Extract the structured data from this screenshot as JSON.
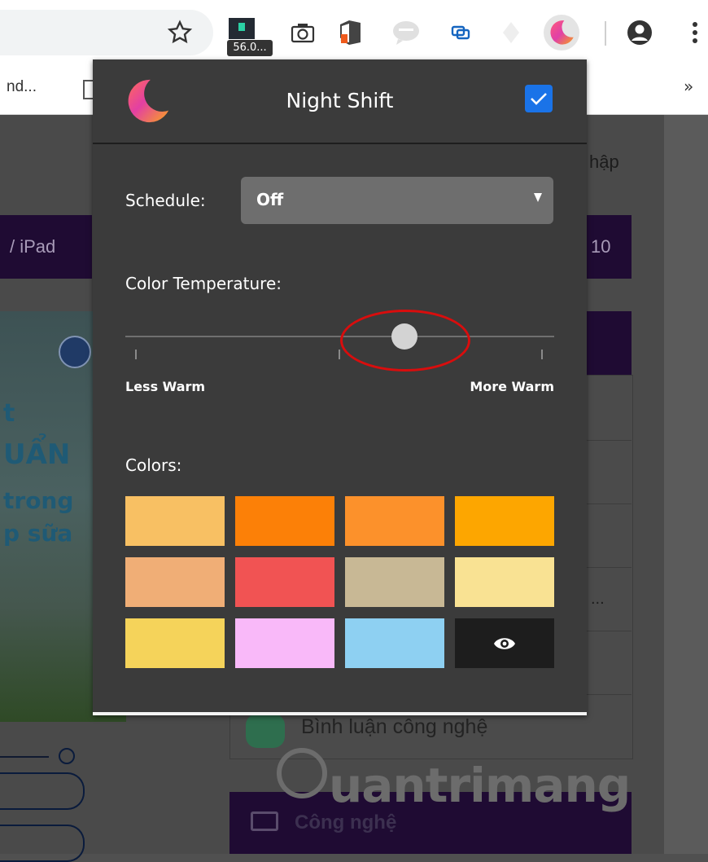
{
  "browser": {
    "badge_text": "56.0...",
    "bookmark_text": "nd...",
    "bookmarks_more": "»"
  },
  "page": {
    "text_login": "hập",
    "text_ipad": "/ iPad",
    "text_10": "10",
    "thumb_text_1": "t",
    "thumb_text_2": "UẨN",
    "thumb_text_3": "trong",
    "thumb_text_4": "p sữa",
    "list_text_ellipsis": "...",
    "list_item_comment": "Bình luận công nghệ",
    "category_button": "Công nghệ",
    "watermark": "uantrimang"
  },
  "popup": {
    "title": "Night Shift",
    "enabled": true,
    "schedule_label": "Schedule:",
    "schedule_value": "Off",
    "temperature_label": "Color Temperature:",
    "temperature_value": 0.65,
    "less_warm_label": "Less Warm",
    "more_warm_label": "More Warm",
    "colors_label": "Colors:",
    "colors": [
      "#f8c063",
      "#fc8007",
      "#fc912b",
      "#fda600",
      "#f0ae76",
      "#f15353",
      "#c8b895",
      "#f9e293",
      "#f5d35a",
      "#f9b9f9",
      "#8ed0f2",
      "#1d1d1d"
    ]
  },
  "icons": {
    "accent": "#1a73e8"
  }
}
